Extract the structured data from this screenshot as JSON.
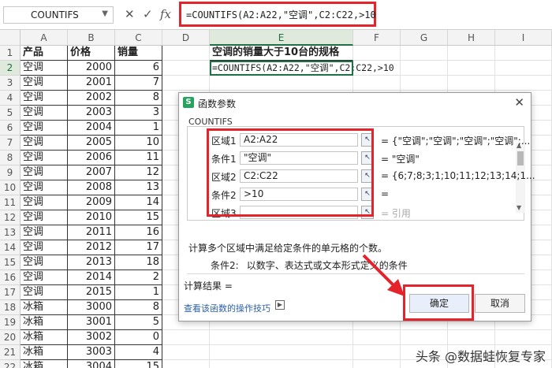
{
  "formula_bar": {
    "name_box": "COUNTIFS",
    "cancel_glyph": "✕",
    "confirm_glyph": "✓",
    "fx_glyph": "fx",
    "formula": "=COUNTIFS(A2:A22,\"空调\",C2:C22,>10"
  },
  "columns": [
    "A",
    "B",
    "C",
    "D",
    "E",
    "F",
    "G",
    "H",
    "I"
  ],
  "rows": [
    [
      "产品",
      "价格",
      "销量"
    ],
    [
      "空调",
      "2000",
      "6"
    ],
    [
      "空调",
      "2001",
      "7"
    ],
    [
      "空调",
      "2002",
      "8"
    ],
    [
      "空调",
      "2003",
      "3"
    ],
    [
      "空调",
      "2004",
      "1"
    ],
    [
      "空调",
      "2005",
      "10"
    ],
    [
      "空调",
      "2006",
      "11"
    ],
    [
      "空调",
      "2007",
      "12"
    ],
    [
      "空调",
      "2008",
      "13"
    ],
    [
      "空调",
      "2009",
      "14"
    ],
    [
      "空调",
      "2010",
      "15"
    ],
    [
      "空调",
      "2011",
      "16"
    ],
    [
      "空调",
      "2012",
      "17"
    ],
    [
      "空调",
      "2013",
      "18"
    ],
    [
      "空调",
      "2014",
      "2"
    ],
    [
      "空调",
      "2015",
      "1"
    ],
    [
      "冰箱",
      "3000",
      "8"
    ],
    [
      "冰箱",
      "3001",
      "5"
    ],
    [
      "冰箱",
      "3002",
      "0"
    ],
    [
      "冰箱",
      "3003",
      "4"
    ],
    [
      "冰箱",
      "3004",
      "15"
    ]
  ],
  "e1_title": "空调的销量大于10台的规格",
  "e2_formula": "=COUNTIFS(A2:A22,\"空调\",C2:C22,>10",
  "dialog": {
    "title": "函数参数",
    "app_icon": "S",
    "close_glyph": "✕",
    "function_name": "COUNTIFS",
    "args": [
      {
        "label": "区域1",
        "value": "A2:A22",
        "result": "= {\"空调\";\"空调\";\"空调\";\"空调\";..."
      },
      {
        "label": "条件1",
        "value": "\"空调\"",
        "result": "= \"空调\""
      },
      {
        "label": "区域2",
        "value": "C2:C22",
        "result": "= {6;7;8;3;1;10;11;12;13;14;1..."
      },
      {
        "label": "条件2",
        "value": ">10",
        "result": "="
      },
      {
        "label": "区域3",
        "value": "",
        "result": "= 引用"
      }
    ],
    "ref_glyph": "↖",
    "description": "计算多个区域中满足给定条件的单元格的个数。",
    "param_label": "条件2:",
    "param_desc": "以数字、表达式或文本形式定义的条件",
    "calc_result": "计算结果 =",
    "help_link": "查看该函数的操作技巧",
    "ok": "确定",
    "cancel": "取消"
  },
  "watermark": "头条 @数据蛙恢复专家",
  "colors": {
    "highlight_red": "#e4232a",
    "selection_green": "#1e7145"
  }
}
